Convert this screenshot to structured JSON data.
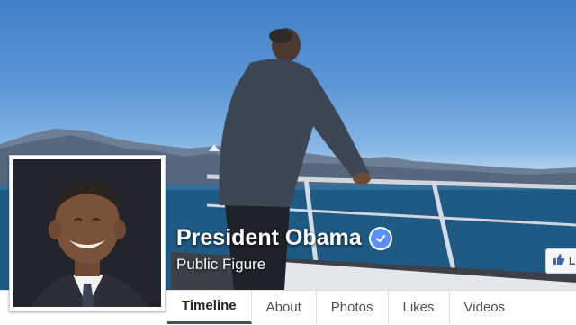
{
  "page": {
    "name": "President Obama",
    "category": "Public Figure",
    "verified": true
  },
  "like_button": {
    "icon": "thumbs-up-icon",
    "label": "L"
  },
  "tabs": [
    {
      "label": "Timeline",
      "active": true
    },
    {
      "label": "About",
      "active": false
    },
    {
      "label": "Photos",
      "active": false
    },
    {
      "label": "Likes",
      "active": false
    },
    {
      "label": "Videos",
      "active": false
    }
  ],
  "colors": {
    "verified_badge": "#5890ff",
    "tab_text": "#4b4f56",
    "like_icon": "#4267b2"
  }
}
